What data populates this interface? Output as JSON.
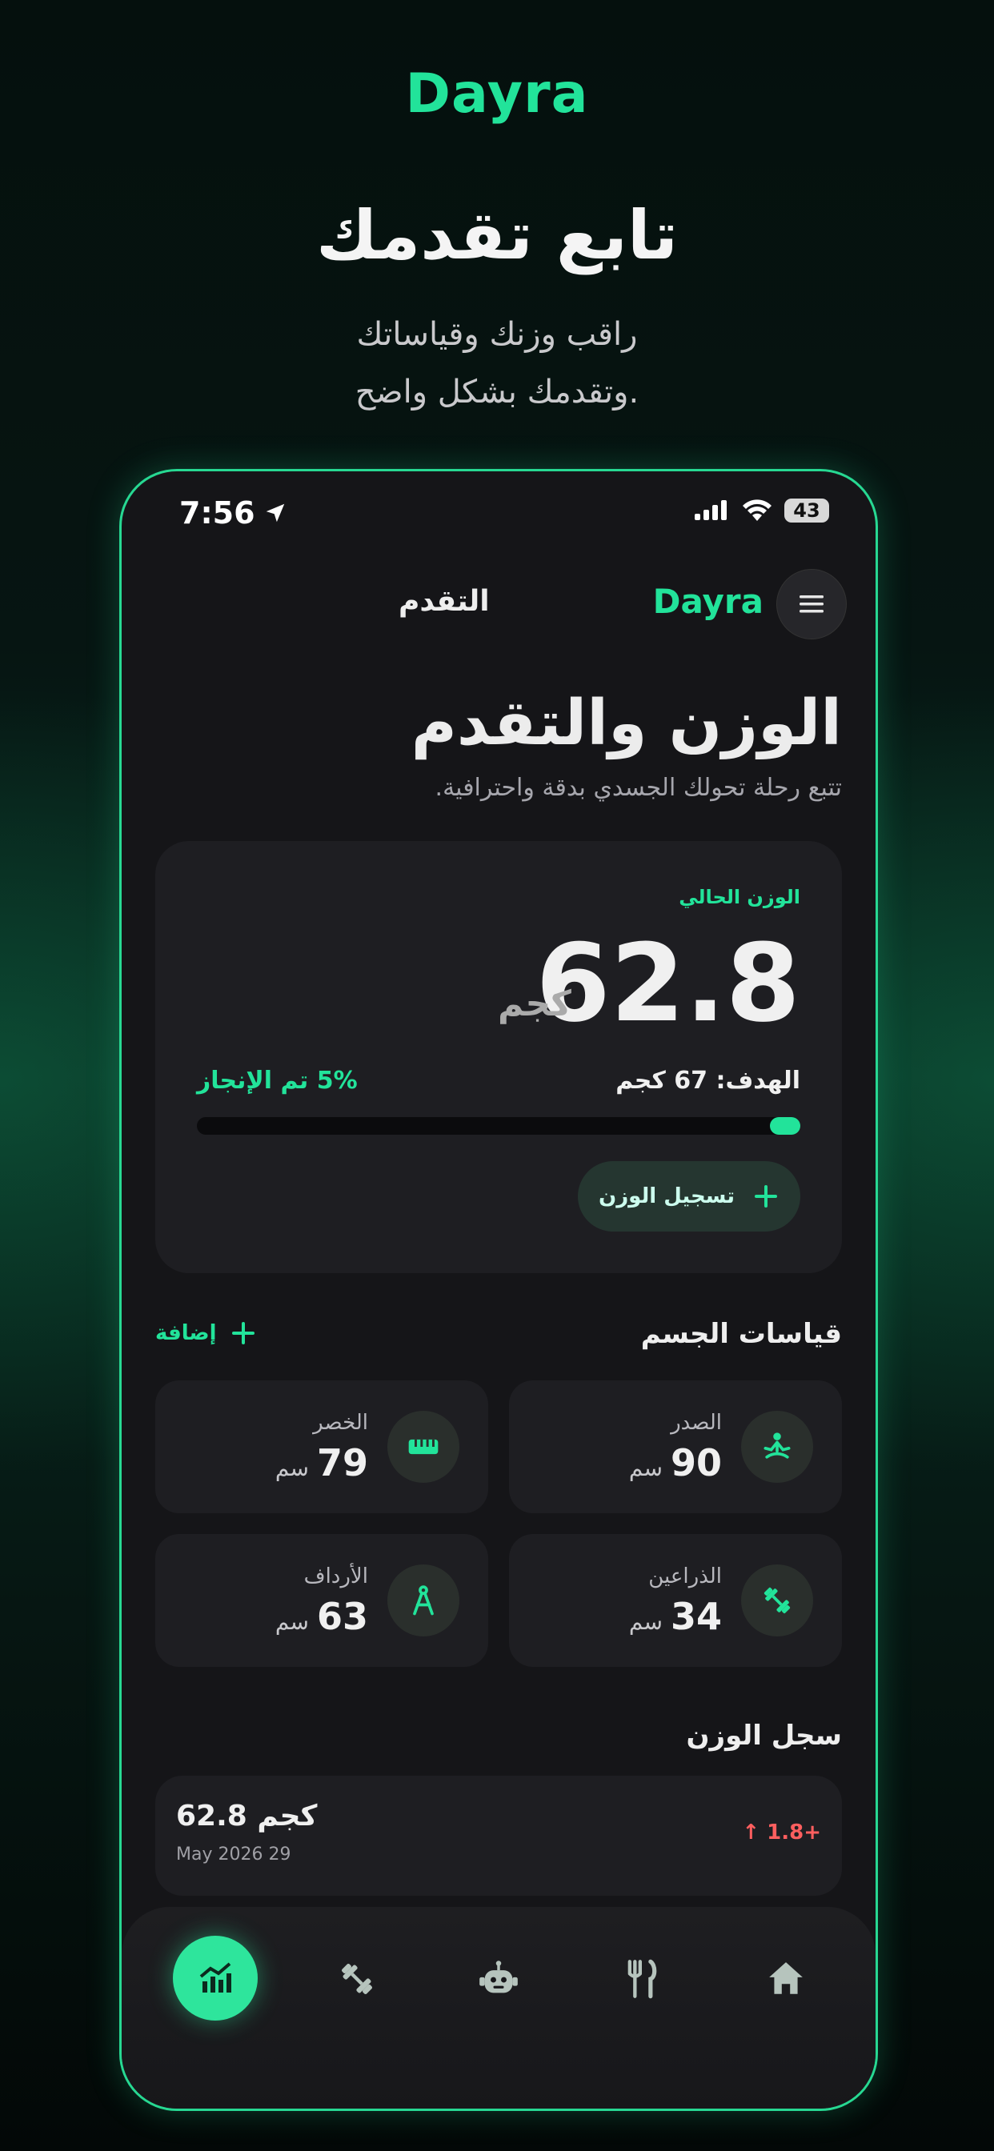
{
  "promo": {
    "brand": "Dayra",
    "title": "تابع تقدمك",
    "subtitle_line1": "راقب وزنك وقياساتك",
    "subtitle_line2": "وتقدمك بشكل واضح."
  },
  "status_bar": {
    "time": "7:56",
    "battery": "43"
  },
  "header": {
    "logo": "Dayra",
    "page_title": "التقدم",
    "menu_icon": "hamburger-icon"
  },
  "page": {
    "title": "الوزن والتقدم",
    "subtitle": "تتبع رحلة تحولك الجسدي بدقة واحترافية."
  },
  "current_weight": {
    "label": "الوزن الحالي",
    "value": "62.8",
    "unit": "كجم",
    "goal": "الهدف: 67 كجم",
    "progress_text": "5% تم الإنجاز",
    "progress_fraction": 0.05,
    "log_button": "تسجيل الوزن"
  },
  "measurements": {
    "title": "قياسات الجسم",
    "add_label": "إضافة",
    "items": [
      {
        "name": "الصدر",
        "value": "90",
        "unit": "سم",
        "icon": "meditation-icon"
      },
      {
        "name": "الخصر",
        "value": "79",
        "unit": "سم",
        "icon": "measuring-tape-icon"
      },
      {
        "name": "الذراعين",
        "value": "34",
        "unit": "سم",
        "icon": "dumbbell-icon"
      },
      {
        "name": "الأرداف",
        "value": "63",
        "unit": "سم",
        "icon": "compass-icon"
      }
    ]
  },
  "weight_log": {
    "title": "سجل الوزن",
    "entries": [
      {
        "weight": "62.8 كجم",
        "date": "May 2026 29",
        "delta": "↑ 1.8+"
      }
    ]
  },
  "bottom_nav": [
    {
      "name": "progress",
      "icon": "chart-icon",
      "active": true
    },
    {
      "name": "workouts",
      "icon": "dumbbell-icon",
      "active": false
    },
    {
      "name": "assistant",
      "icon": "robot-icon",
      "active": false
    },
    {
      "name": "nutrition",
      "icon": "utensils-icon",
      "active": false
    },
    {
      "name": "home",
      "icon": "home-icon",
      "active": false
    }
  ],
  "colors": {
    "accent": "#22e39a",
    "negative": "#ff5f5f",
    "card": "#1e1e22"
  }
}
